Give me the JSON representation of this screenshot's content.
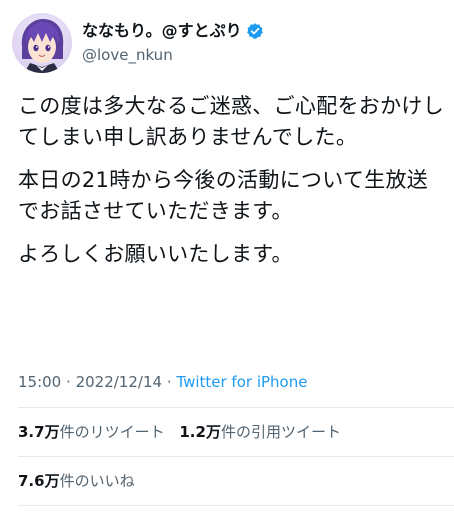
{
  "user": {
    "display_name": "ななもり。@すとぷり",
    "handle": "@love_nkun",
    "avatar_icon": "avatar-image",
    "verified_icon": "verified-badge-icon",
    "verified_color": "#1d9bf0"
  },
  "tweet": {
    "paragraphs": [
      "この度は多大なるご迷惑、ご心配をおかけしてしまい申し訳ありませんでした。",
      "本日の21時から今後の活動について生放送でお話させていただきます。",
      "よろしくお願いいたします。"
    ],
    "time": "15:00",
    "separator": "·",
    "date": "2022/12/14",
    "source": "Twitter for iPhone"
  },
  "stats": {
    "retweets": {
      "count": "3.7万",
      "label": "件のリツイート"
    },
    "quotes": {
      "count": "1.2万",
      "label": "件の引用ツイート"
    },
    "likes": {
      "count": "7.6万",
      "label": "件のいいね"
    }
  },
  "colors": {
    "text": "#0f1419",
    "secondary": "#536471",
    "link": "#1d9bf0",
    "divider": "#e6e9ec"
  }
}
